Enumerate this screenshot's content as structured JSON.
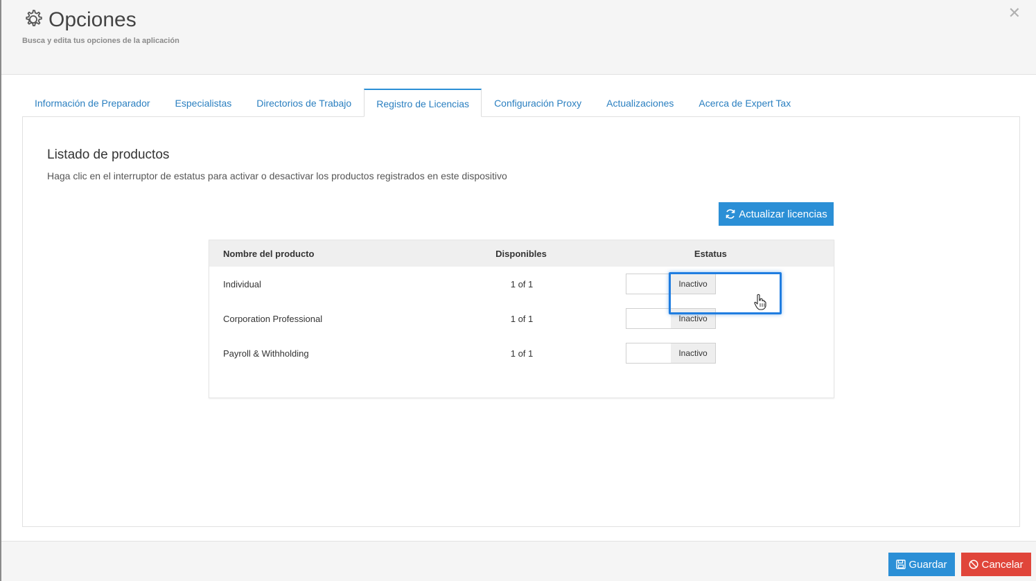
{
  "header": {
    "title": "Opciones",
    "subtitle": "Busca y edita tus opciones de la aplicación",
    "icon": "gear-icon",
    "close_icon": "close-icon"
  },
  "tabs": [
    {
      "label": "Información de Preparador",
      "active": false
    },
    {
      "label": "Especialistas",
      "active": false
    },
    {
      "label": "Directorios de Trabajo",
      "active": false
    },
    {
      "label": "Registro de Licencias",
      "active": true
    },
    {
      "label": "Configuración Proxy",
      "active": false
    },
    {
      "label": "Actualizaciones",
      "active": false
    },
    {
      "label": "Acerca de Expert Tax",
      "active": false
    }
  ],
  "licenses": {
    "title": "Listado de productos",
    "description": "Haga clic en el interruptor de estatus para activar o desactivar los productos registrados en este dispositivo",
    "refresh_label": "Actualizar licencias",
    "columns": [
      "Nombre del producto",
      "Disponibles",
      "Estatus"
    ],
    "rows": [
      {
        "name": "Individual",
        "available": "1 of 1",
        "status": "Inactivo"
      },
      {
        "name": "Corporation Professional",
        "available": "1 of 1",
        "status": "Inactivo"
      },
      {
        "name": "Payroll & Withholding",
        "available": "1 of 1",
        "status": "Inactivo"
      }
    ]
  },
  "footer": {
    "save_label": "Guardar",
    "cancel_label": "Cancelar"
  },
  "colors": {
    "primary": "#2b8fd6",
    "danger": "#e0453a",
    "tab_text": "#2a7fc0",
    "highlight": "#1f7de0"
  }
}
